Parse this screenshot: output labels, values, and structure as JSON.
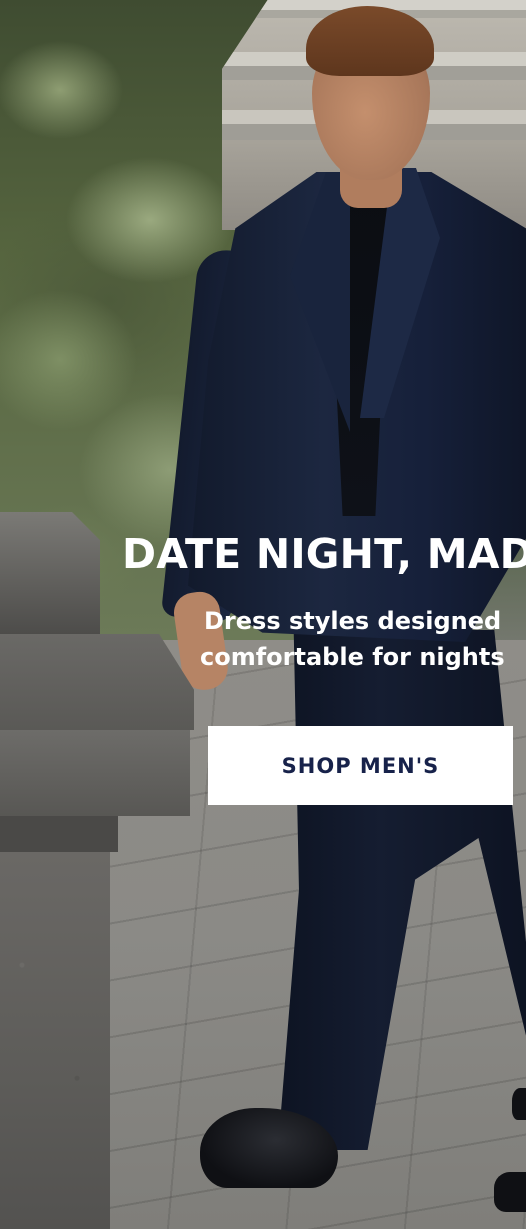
{
  "hero": {
    "headline": "DATE NIGHT, MAD",
    "subline_line1": "Dress styles designed",
    "subline_line2": "comfortable for nights",
    "cta_label": "SHOP MEN'S"
  },
  "colors": {
    "headline_text": "#ffffff",
    "button_background": "#ffffff",
    "button_text": "#17224a"
  }
}
